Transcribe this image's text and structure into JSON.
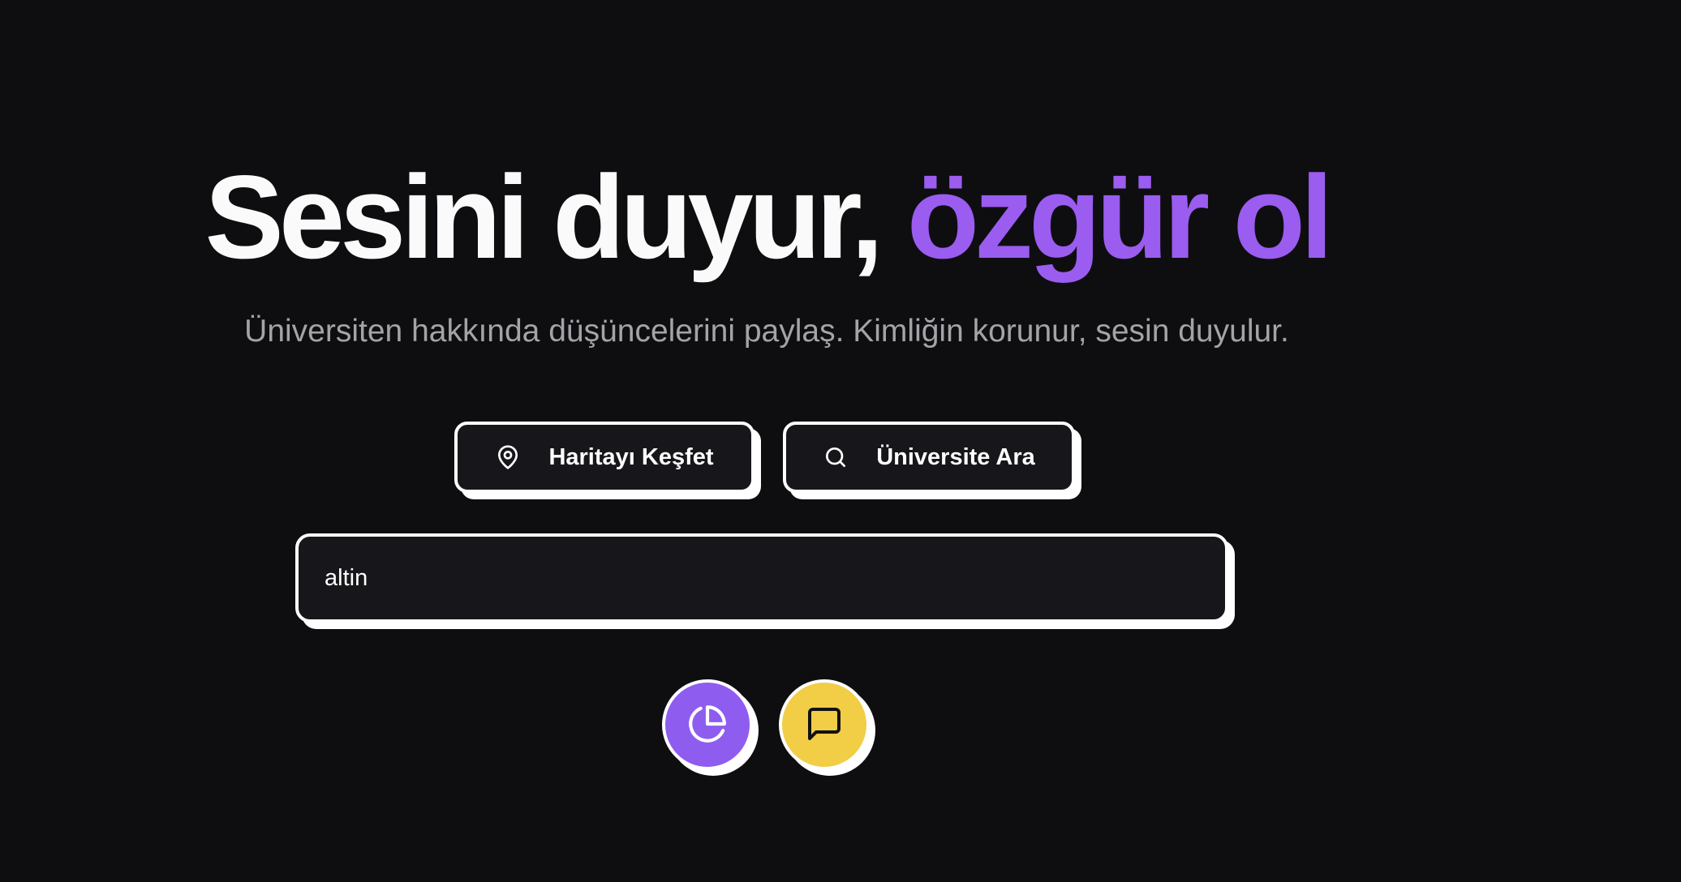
{
  "hero": {
    "title_plain": "Sesini duyur,",
    "title_accent": "özgür ol",
    "subtitle": "Üniversiten hakkında düşüncelerini paylaş. Kimliğin korunur, sesin duyulur."
  },
  "actions": {
    "map_label": "Haritayı Keşfet",
    "map_icon": "map-pin-icon",
    "search_label": "Üniversite Ara",
    "search_icon": "search-icon"
  },
  "search": {
    "value": "altin"
  },
  "floating_buttons": {
    "stats_icon": "pie-chart-icon",
    "chat_icon": "message-square-icon"
  },
  "colors": {
    "background": "#0e0e11",
    "accent_purple": "#9b5cf0",
    "accent_yellow": "#f2cd46",
    "border": "#ffffff"
  }
}
